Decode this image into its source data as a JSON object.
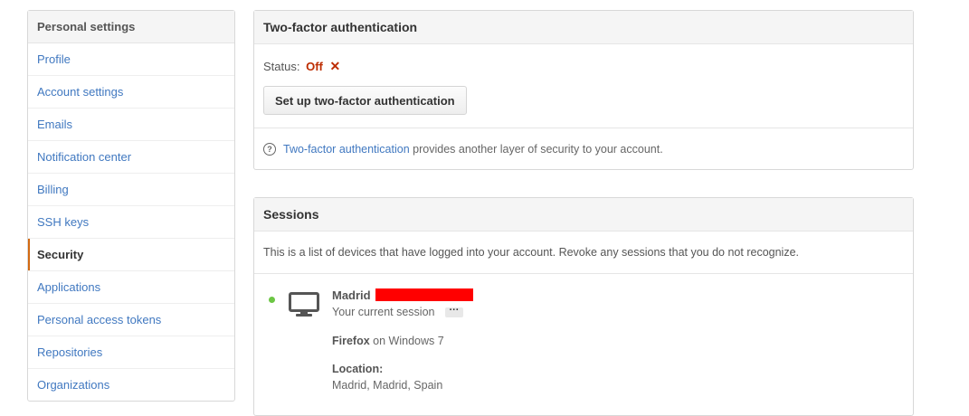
{
  "sidebar": {
    "header": "Personal settings",
    "items": [
      {
        "label": "Profile"
      },
      {
        "label": "Account settings"
      },
      {
        "label": "Emails"
      },
      {
        "label": "Notification center"
      },
      {
        "label": "Billing"
      },
      {
        "label": "SSH keys"
      },
      {
        "label": "Security",
        "active": true
      },
      {
        "label": "Applications"
      },
      {
        "label": "Personal access tokens"
      },
      {
        "label": "Repositories"
      },
      {
        "label": "Organizations"
      }
    ]
  },
  "two_factor": {
    "title": "Two-factor authentication",
    "status_label": "Status:",
    "status_value": "Off",
    "status_icon": "✕",
    "setup_button": "Set up two-factor authentication",
    "help_link": "Two-factor authentication",
    "help_text": " provides another layer of security to your account."
  },
  "sessions": {
    "title": "Sessions",
    "description": "This is a list of devices that have logged into your account. Revoke any sessions that you do not recognize.",
    "current": {
      "location_name": "Madrid",
      "current_label": "Your current session",
      "more_label": "···",
      "browser": "Firefox",
      "os_text": " on Windows 7",
      "location_label": "Location:",
      "location_value": "Madrid, Madrid, Spain"
    }
  },
  "colors": {
    "link": "#4078c0",
    "active_marker": "#d26911",
    "status_off": "#bd2c00",
    "online_dot": "#6cc644",
    "redaction": "#ff0000"
  }
}
